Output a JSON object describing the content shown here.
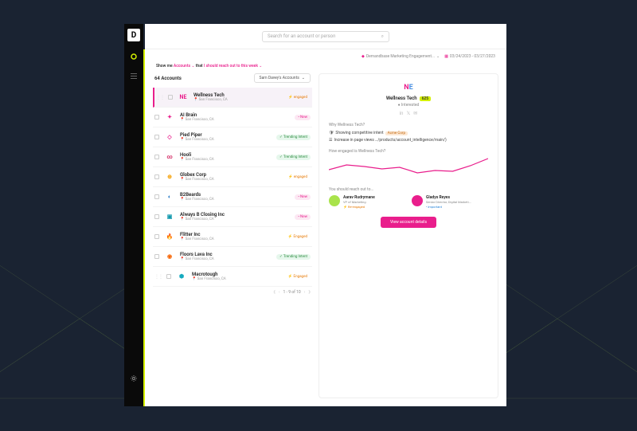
{
  "search": {
    "placeholder": "Search for an account or person"
  },
  "filters": {
    "segment_label": "Demandbase Marketing Engagement...",
    "date_range": "03/24/2023 - 03/27/2023",
    "show_prefix": "Show me",
    "show_entity": "Accounts",
    "show_that": "that",
    "show_filter": "I should reach out to this week"
  },
  "list": {
    "count_label": "64 Accounts",
    "dropdown_label": "Sam Davey's Accounts",
    "pagination": "1 - 9 of 10"
  },
  "accounts": [
    {
      "name": "Wellness Tech",
      "loc": "San Francisco, CA",
      "tag": "engaged",
      "tag_text": "⚡ engaged",
      "logo_text": "NE",
      "logo_bg": "#fff",
      "logo_color1": "#e91e8c",
      "logo_color2": "#4a90e2"
    },
    {
      "name": "AI Brain",
      "loc": "San Francisco, CA",
      "tag": "new",
      "tag_text": "• New",
      "logo_text": "✦",
      "logo_bg": "#fff",
      "logo_color1": "#e91e8c"
    },
    {
      "name": "Pied Piper",
      "loc": "San Francisco, CA",
      "tag": "trending",
      "tag_text": "✓ Trending Intent",
      "logo_text": "◇",
      "logo_bg": "#fff",
      "logo_color1": "#e91e8c"
    },
    {
      "name": "Hooli",
      "loc": "San Francisco, CA",
      "tag": "trending",
      "tag_text": "✓ Trending Intent",
      "logo_text": "∞",
      "logo_bg": "#fff",
      "logo_color1": "#d6336c"
    },
    {
      "name": "Globex Corp",
      "loc": "San Francisco, CA",
      "tag": "engaged",
      "tag_text": "⚡ engaged",
      "logo_text": "⊕",
      "logo_bg": "#fff",
      "logo_color1": "#f59f00"
    },
    {
      "name": "B2Beards",
      "loc": "San Francisco, CA",
      "tag": "new",
      "tag_text": "• New",
      "logo_text": "◐",
      "logo_bg": "#fff",
      "logo_color1": "#1971c2"
    },
    {
      "name": "Always B Closing Inc",
      "loc": "San Francisco, CA",
      "tag": "new",
      "tag_text": "• New",
      "logo_text": "▣",
      "logo_bg": "#fff",
      "logo_color1": "#1098ad"
    },
    {
      "name": "Flitter Inc",
      "loc": "San Francisco, CA",
      "tag": "engaged",
      "tag_text": "⚡ Engaged",
      "logo_text": "🔥",
      "logo_bg": "#fff",
      "logo_color1": "#fd7e14"
    },
    {
      "name": "Floors Lava Inc",
      "loc": "San Francisco, CA",
      "tag": "trending",
      "tag_text": "✓ Trending Intent",
      "logo_text": "◉",
      "logo_bg": "#fff",
      "logo_color1": "#f76707"
    },
    {
      "name": "Macrotough",
      "loc": "San Francisco, CA",
      "tag": "engaged",
      "tag_text": "⚡ Engaged",
      "logo_text": "⬢",
      "logo_bg": "#fff",
      "logo_color1": "#15aabf"
    }
  ],
  "detail": {
    "name": "Wellness Tech",
    "score": "625",
    "status": "● Interested",
    "why_title": "Why Wellness Tech?",
    "insight1_prefix": "Showing competitive intent",
    "insight1_tag": "Acme Corp",
    "insight2": "Increase in page views …/products/account_intelligence/main/)",
    "engaged_title": "How engaged is Wellness Tech?",
    "reach_title": "You should reach out to...",
    "cta": "View account details"
  },
  "contacts": [
    {
      "name": "Aarav Rudrymane",
      "title": "VP of Marketing",
      "tag": "⚡ Re-engaged",
      "tag_color": "#e67700",
      "avatar_bg": "#a9e34b"
    },
    {
      "name": "Gladys Reyes",
      "title": "Senior Director, Digital Marketi...",
      "tag": "• Important",
      "tag_color": "#1c7ed6",
      "avatar_bg": "#e91e8c"
    }
  ],
  "chart_data": {
    "type": "line",
    "title": "How engaged is Wellness Tech?",
    "xlabel": "",
    "ylabel": "",
    "x": [
      0,
      1,
      2,
      3,
      4,
      5,
      6,
      7,
      8,
      9
    ],
    "values": [
      14,
      20,
      18,
      15,
      17,
      10,
      13,
      12,
      19,
      28
    ],
    "ylim": [
      0,
      30
    ]
  }
}
